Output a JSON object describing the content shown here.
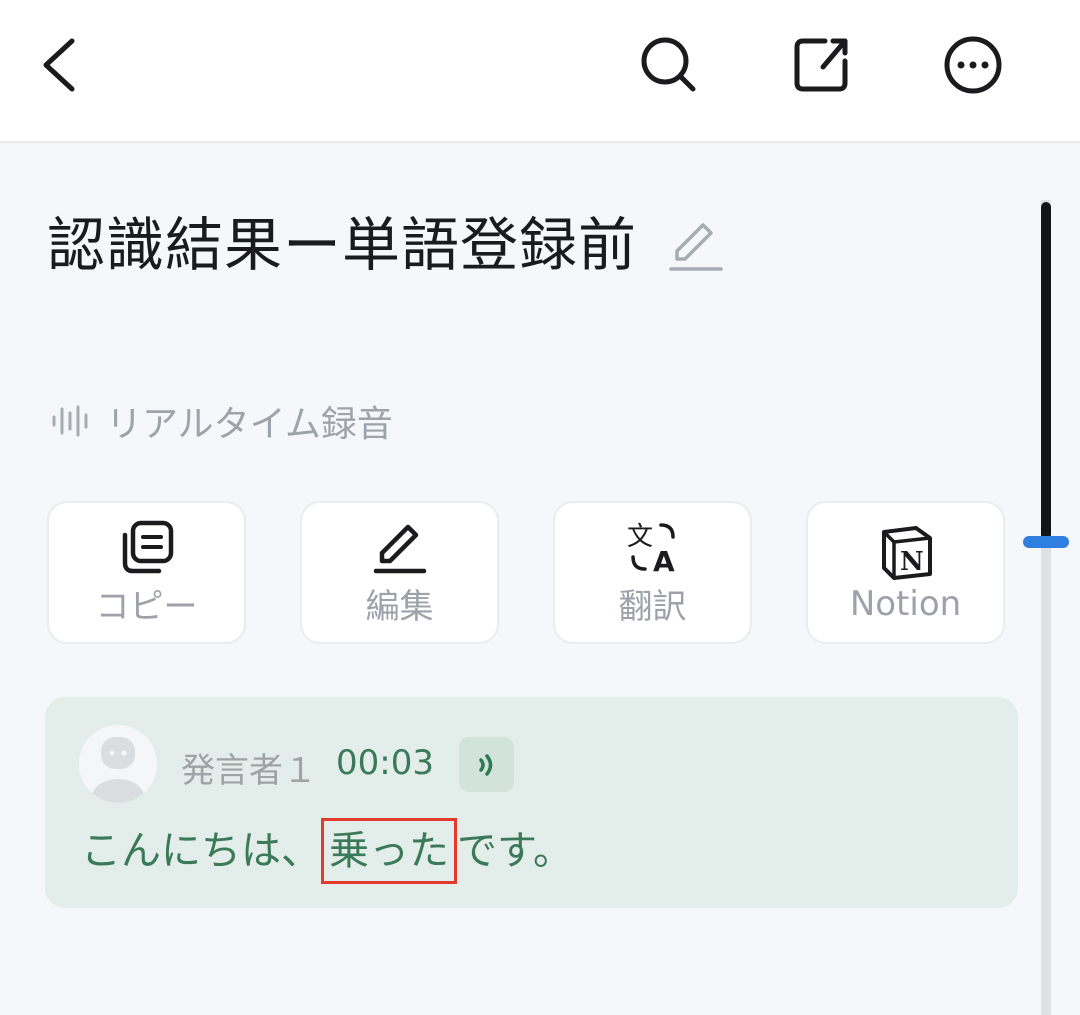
{
  "header": {
    "back_icon": "chevron-left-icon",
    "search_icon": "search-icon",
    "share_icon": "share-icon",
    "more_icon": "more-icon"
  },
  "note": {
    "title": "認識結果ー単語登録前",
    "source_label": "リアルタイム録音"
  },
  "actions": [
    {
      "label": "コピー",
      "icon": "copy-icon"
    },
    {
      "label": "編集",
      "icon": "pencil-icon"
    },
    {
      "label": "翻訳",
      "icon": "translate-icon"
    },
    {
      "label": "Notion",
      "icon": "notion-icon"
    }
  ],
  "transcript": {
    "speaker": "発言者１",
    "timestamp": "00:03",
    "text_before": "こんにちは、",
    "text_highlight": "乗った",
    "text_after": "です。"
  },
  "colors": {
    "accent": "#3b7a58",
    "highlight_border": "#e23a2e",
    "scroll_handle": "#2f7fe0"
  }
}
